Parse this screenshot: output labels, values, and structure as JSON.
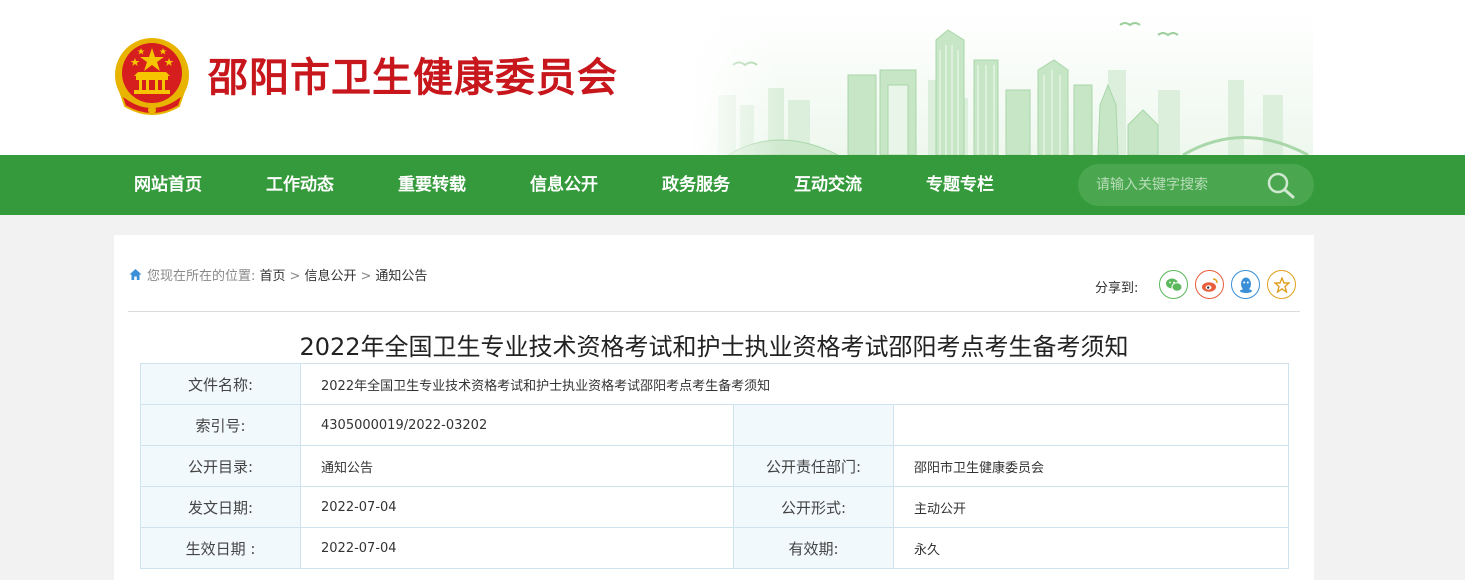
{
  "site": {
    "title": "邵阳市卫生健康委员会"
  },
  "nav": {
    "items": [
      "网站首页",
      "工作动态",
      "重要转载",
      "信息公开",
      "政务服务",
      "互动交流",
      "专题专栏"
    ],
    "search_placeholder": "请输入关键字搜索"
  },
  "breadcrumb": {
    "prefix": "您现在所在的位置:",
    "items": [
      "首页",
      "信息公开",
      "通知公告"
    ],
    "separator": ">"
  },
  "share": {
    "label": "分享到:",
    "buttons": [
      {
        "icon": "wechat-icon",
        "color": "#5cb85c"
      },
      {
        "icon": "weibo-icon",
        "color": "#e85d3b"
      },
      {
        "icon": "qq-icon",
        "color": "#3a8fd6"
      },
      {
        "icon": "favorite-star-icon",
        "color": "#e0a020"
      }
    ]
  },
  "article": {
    "title": "2022年全国卫生专业技术资格考试和护士执业资格考试邵阳考点考生备考须知"
  },
  "meta": {
    "doc_name_label": "文件名称:",
    "doc_name": "2022年全国卫生专业技术资格考试和护士执业资格考试邵阳考点考生备考须知",
    "index_label": "索引号:",
    "index_value": "4305000019/2022-03202",
    "catalog_label": "公开目录:",
    "catalog_value": "通知公告",
    "dept_label": "公开责任部门:",
    "dept_value": "邵阳市卫生健康委员会",
    "issue_label": "发文日期:",
    "issue_value": "2022-07-04",
    "form_label": "公开形式:",
    "form_value": "主动公开",
    "effective_label": "生效日期 :",
    "effective_value": "2022-07-04",
    "validity_label": "有效期:",
    "validity_value": "永久"
  },
  "colors": {
    "brand_red": "#c8161d",
    "nav_green": "#359a3b",
    "table_border": "#cfe3ef",
    "label_bg": "#f2f9fd"
  }
}
